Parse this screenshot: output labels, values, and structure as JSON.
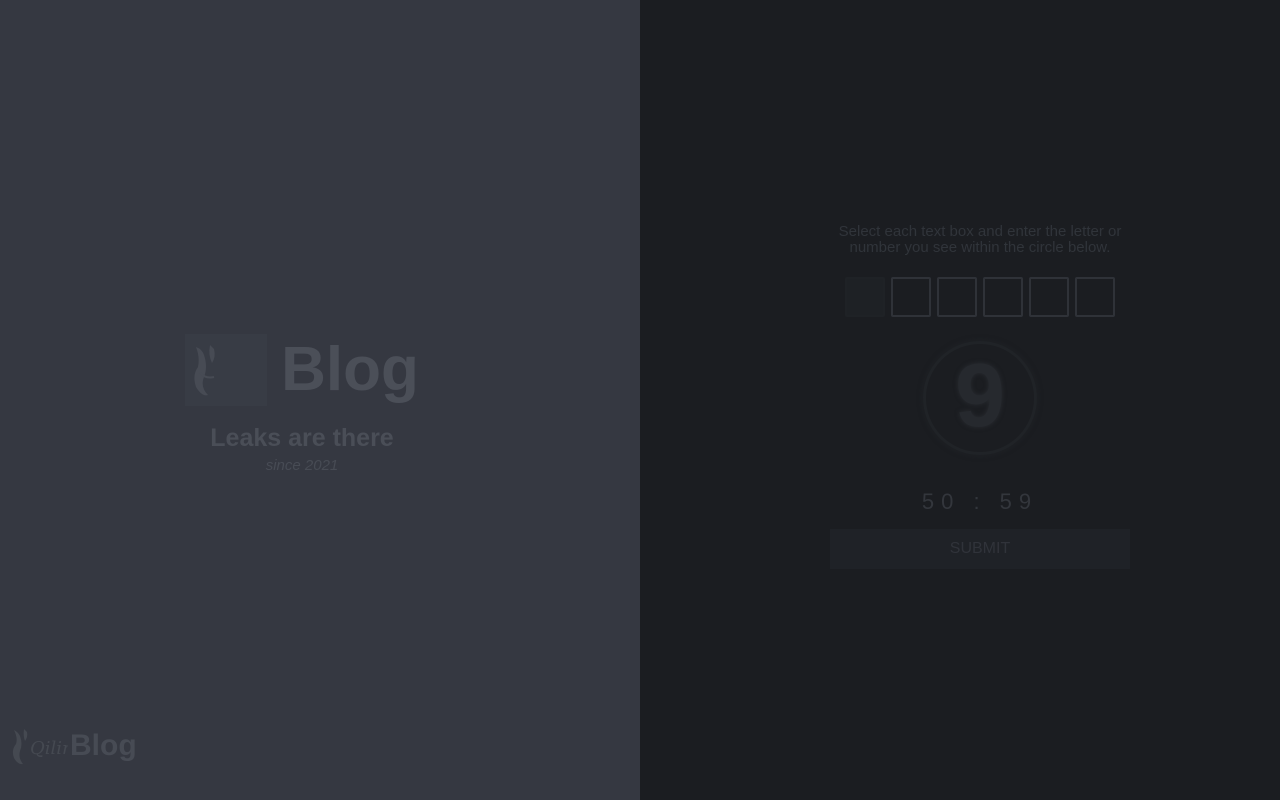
{
  "brand": {
    "logo_text": "Qilin",
    "title": "Blog",
    "tagline": "Leaks are there",
    "since": "since 2021"
  },
  "footer": {
    "logo_text": "Qilin",
    "title": "Blog"
  },
  "captcha": {
    "instruction": "Select each text box and enter the letter or number you see within the circle below.",
    "boxes": [
      "",
      "",
      "",
      "",
      "",
      ""
    ],
    "circle_char": "9",
    "timer": "50 : 59",
    "submit_label": "SUBMIT"
  },
  "colors": {
    "left_bg": "#353841",
    "right_bg": "#1b1d21"
  }
}
